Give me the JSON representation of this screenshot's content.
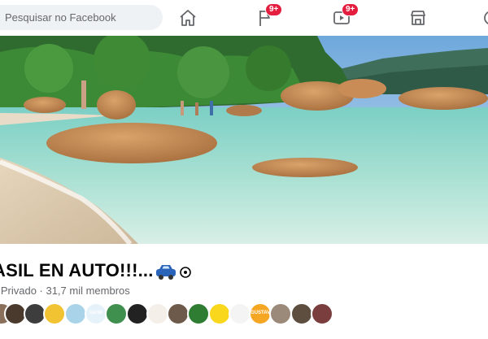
{
  "topbar": {
    "search_placeholder": "Pesquisar no Facebook",
    "nav": [
      {
        "name": "home",
        "icon": "home-icon"
      },
      {
        "name": "flag",
        "icon": "flag-icon",
        "badge": "9+"
      },
      {
        "name": "watch",
        "icon": "video-icon",
        "badge": "9+"
      },
      {
        "name": "marketplace",
        "icon": "marketplace-icon"
      }
    ]
  },
  "group": {
    "name": "ASIL EN AUTO!!!...",
    "meta": "o Privado · 31,7 mil membros",
    "car_emoji_icon": "car-icon",
    "privacy_icon": "target-icon"
  },
  "members": [
    {
      "label": "",
      "color": "#8a6f5a"
    },
    {
      "label": "",
      "color": "#4a3a2e"
    },
    {
      "label": "",
      "color": "#3d3d3d"
    },
    {
      "label": "",
      "color": "#f1c232"
    },
    {
      "label": "",
      "color": "#a8d3e8"
    },
    {
      "label": "Varilé",
      "color": "#e6f2fa"
    },
    {
      "label": "",
      "color": "#3f8f4f"
    },
    {
      "label": "",
      "color": "#222222"
    },
    {
      "label": "",
      "color": "#f4efe8"
    },
    {
      "label": "",
      "color": "#6e5a4a"
    },
    {
      "label": "",
      "color": "#2e7d32"
    },
    {
      "label": "",
      "color": "#f9d71c"
    },
    {
      "label": "",
      "color": "#f4f4f4"
    },
    {
      "label": "GUSTAVO FAYA",
      "color": "#f5a623"
    },
    {
      "label": "",
      "color": "#9b8a7a"
    },
    {
      "label": "",
      "color": "#5d4e40"
    },
    {
      "label": "",
      "color": "#7a3e3e"
    }
  ],
  "colors": {
    "badge": "#e41e3f",
    "icon": "#65676b",
    "meta": "#65676b"
  }
}
